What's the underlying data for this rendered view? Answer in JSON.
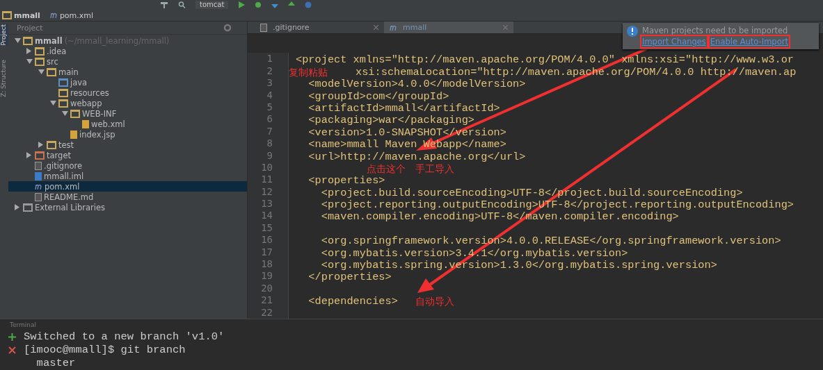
{
  "toolbar": {
    "run_config": "tomcat"
  },
  "breadcrumbs": [
    {
      "label": "mmall",
      "kind": "folder"
    },
    {
      "label": "pom.xml",
      "kind": "maven"
    }
  ],
  "tool_strip": [
    {
      "label": "Project",
      "selected": true
    },
    {
      "label": "Z: Structure",
      "selected": false
    }
  ],
  "project_panel": {
    "title": "Project",
    "tree": [
      {
        "name": "mmall",
        "path": "(~/mmall_learning/mmall)",
        "kind": "module",
        "expanded": true,
        "selected": false,
        "children": [
          {
            "name": ".idea",
            "kind": "folder",
            "expanded": false,
            "selected": false
          },
          {
            "name": "src",
            "kind": "folder",
            "expanded": true,
            "selected": false,
            "children": [
              {
                "name": "main",
                "kind": "folder",
                "expanded": true,
                "selected": false,
                "children": [
                  {
                    "name": "java",
                    "kind": "source",
                    "selected": false
                  },
                  {
                    "name": "resources",
                    "kind": "resources",
                    "selected": false
                  },
                  {
                    "name": "webapp",
                    "kind": "web",
                    "expanded": true,
                    "selected": false,
                    "children": [
                      {
                        "name": "WEB-INF",
                        "kind": "folder",
                        "expanded": true,
                        "selected": false,
                        "children": [
                          {
                            "name": "web.xml",
                            "kind": "xml",
                            "selected": false
                          }
                        ]
                      },
                      {
                        "name": "index.jsp",
                        "kind": "jsp",
                        "selected": false
                      }
                    ]
                  }
                ]
              },
              {
                "name": "test",
                "kind": "folder",
                "expanded": false,
                "selected": false
              }
            ]
          },
          {
            "name": "target",
            "kind": "excluded",
            "expanded": false,
            "selected": false
          },
          {
            "name": ".gitignore",
            "kind": "text",
            "selected": false
          },
          {
            "name": "mmall.iml",
            "kind": "iml",
            "selected": false
          },
          {
            "name": "pom.xml",
            "kind": "maven",
            "selected": true
          },
          {
            "name": "README.md",
            "kind": "text",
            "selected": false
          }
        ]
      },
      {
        "name": "External Libraries",
        "kind": "libraries",
        "expanded": false,
        "selected": false
      }
    ]
  },
  "editor_tabs": [
    {
      "label": ".gitignore",
      "kind": "text",
      "selected": false
    },
    {
      "label": "mmall",
      "kind": "maven",
      "selected": true
    }
  ],
  "notification": {
    "message": "Maven projects need to be imported",
    "links": [
      {
        "label": "Import Changes",
        "highlighted": true
      },
      {
        "label": "Enable Auto-Import",
        "highlighted": true
      }
    ]
  },
  "code_lines": [
    {
      "number": "1",
      "text": "<project xmlns=\"http://maven.apache.org/POM/4.0.0\" xmlns:xsi=\"http://www.w3.or"
    },
    {
      "number": "2",
      "continuation": true,
      "text": "xsi:schemaLocation=\"http://maven.apache.org/POM/4.0.0 http://maven.ap"
    },
    {
      "number": "3",
      "text": "  <modelVersion>4.0.0</modelVersion>"
    },
    {
      "number": "4",
      "text": "  <groupId>com</groupId>"
    },
    {
      "number": "5",
      "text": "  <artifactId>mmall</artifactId>"
    },
    {
      "number": "6",
      "text": "  <packaging>war</packaging>"
    },
    {
      "number": "7",
      "text": "  <version>1.0-SNAPSHOT</version>"
    },
    {
      "number": "8",
      "text": "  <name>mmall Maven Webapp</name>"
    },
    {
      "number": "9",
      "text": "  <url>http://maven.apache.org</url>"
    },
    {
      "number": "10"
    },
    {
      "number": "11",
      "text": "  <properties>"
    },
    {
      "number": "12",
      "text": "    <project.build.sourceEncoding>UTF-8</project.build.sourceEncoding>"
    },
    {
      "number": "13",
      "text": "    <project.reporting.outputEncoding>UTF-8</project.reporting.outputEncoding>"
    },
    {
      "number": "14",
      "text": "    <maven.compiler.encoding>UTF-8</maven.compiler.encoding>"
    },
    {
      "number": "15"
    },
    {
      "number": "16",
      "text": "    <org.springframework.version>4.0.0.RELEASE</org.springframework.version>"
    },
    {
      "number": "17",
      "text": "    <org.mybatis.version>3.4.1</org.mybatis.version>"
    },
    {
      "number": "18",
      "text": "    <org.mybatis.spring.version>1.3.0</org.mybatis.spring.version>"
    },
    {
      "number": "19",
      "text": "  </properties>"
    },
    {
      "number": "20"
    },
    {
      "number": "21",
      "text": "  <dependencies>"
    },
    {
      "number": "22"
    }
  ],
  "annotations": [
    {
      "text": "复制粘贴"
    },
    {
      "text": "点击这个　手工导入"
    },
    {
      "text": "自动导入"
    }
  ],
  "terminal": {
    "title": "Terminal",
    "lines": [
      {
        "text": "Switched to a new branch 'v1.0'"
      },
      {
        "text": "[imooc@mmall]$ git branch"
      },
      {
        "text": "  master"
      }
    ]
  }
}
